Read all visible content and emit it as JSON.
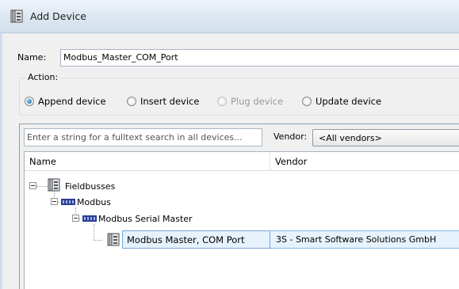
{
  "window": {
    "title": "Add Device",
    "title_icon": "device-module-icon"
  },
  "name_field": {
    "label": "Name:",
    "value": "Modbus_Master_COM_Port"
  },
  "action": {
    "label": "Action:",
    "options": [
      {
        "label": "Append device",
        "checked": true,
        "enabled": true
      },
      {
        "label": "Insert device",
        "checked": false,
        "enabled": true
      },
      {
        "label": "Plug device",
        "checked": false,
        "enabled": false
      },
      {
        "label": "Update device",
        "checked": false,
        "enabled": true
      }
    ]
  },
  "search": {
    "placeholder": "Enter a string for a fulltext search in all devices..."
  },
  "vendor": {
    "label": "Vendor:",
    "selected": "<All vendors>"
  },
  "tree": {
    "columns": [
      "Name",
      "Vendor"
    ],
    "items": [
      {
        "label": "Fieldbusses",
        "icon": "device-module-icon",
        "level": 0,
        "expanded": true
      },
      {
        "label": "Modbus",
        "icon": "bus-icon",
        "level": 1,
        "expanded": true
      },
      {
        "label": "Modbus Serial Master",
        "icon": "bus-icon",
        "level": 2,
        "expanded": true
      },
      {
        "label": "Modbus Master, COM Port",
        "icon": "device-module-icon",
        "level": 3,
        "selected": true,
        "vendor": "3S - Smart Software Solutions GmbH"
      }
    ]
  },
  "colors": {
    "selection_bg": "#e6f2fc",
    "selection_border": "#84b9e6",
    "title_gradient_top": "#eef3f9",
    "radio_checked": "#1a64a8"
  }
}
